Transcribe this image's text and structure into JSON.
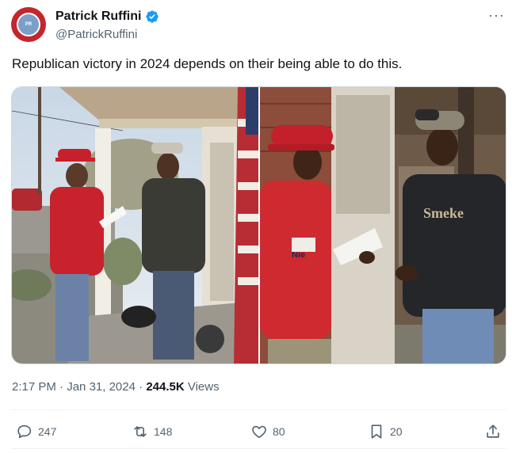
{
  "author": {
    "display_name": "Patrick Ruffini",
    "handle": "@PatrickRuffini",
    "verified": true,
    "avatar_text": "PATRICK RUFFINI"
  },
  "more_label": "···",
  "tweet": {
    "text": "Republican victory in 2024 depends on their being able to do this."
  },
  "media": {
    "left_shirt_text": "Nie",
    "right_shirt_text": "Smeke"
  },
  "meta": {
    "time": "2:17 PM",
    "separator": "·",
    "date": "Jan 31, 2024",
    "views_count": "244.5K",
    "views_label": "Views"
  },
  "actions": {
    "replies": "247",
    "reposts": "148",
    "likes": "80",
    "bookmarks": "20"
  },
  "colors": {
    "accent": "#1d9bf0",
    "text_primary": "#0f1419",
    "text_secondary": "#536471",
    "border": "#cfd9de"
  }
}
